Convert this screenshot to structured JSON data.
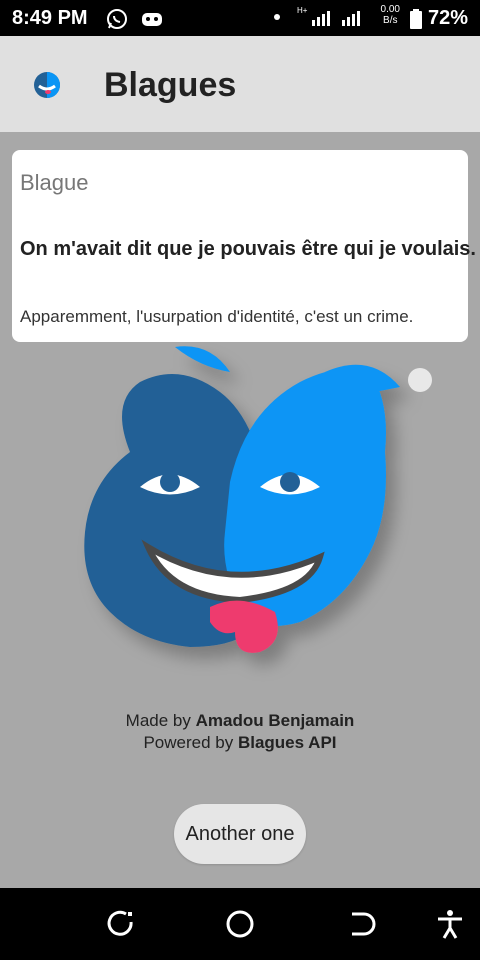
{
  "status_bar": {
    "time": "8:49 PM",
    "network_speed_value": "0.00",
    "network_speed_unit": "B/s",
    "network_type": "H+",
    "battery": "72%"
  },
  "app_bar": {
    "title": "Blagues"
  },
  "joke_card": {
    "title": "Blague",
    "question": "On m'avait dit que je pouvais être qui je voulais.",
    "answer": "Apparemment, l'usurpation d'identité, c'est un crime."
  },
  "credits": {
    "made_by_prefix": "Made by ",
    "author": "Amadou Benjamain",
    "powered_by_prefix": "Powered by ",
    "api": "Blagues API"
  },
  "actions": {
    "another_label": "Another one"
  },
  "colors": {
    "mascot_dark": "#236196",
    "mascot_light": "#0a95f5",
    "tongue": "#ee3b6e"
  }
}
